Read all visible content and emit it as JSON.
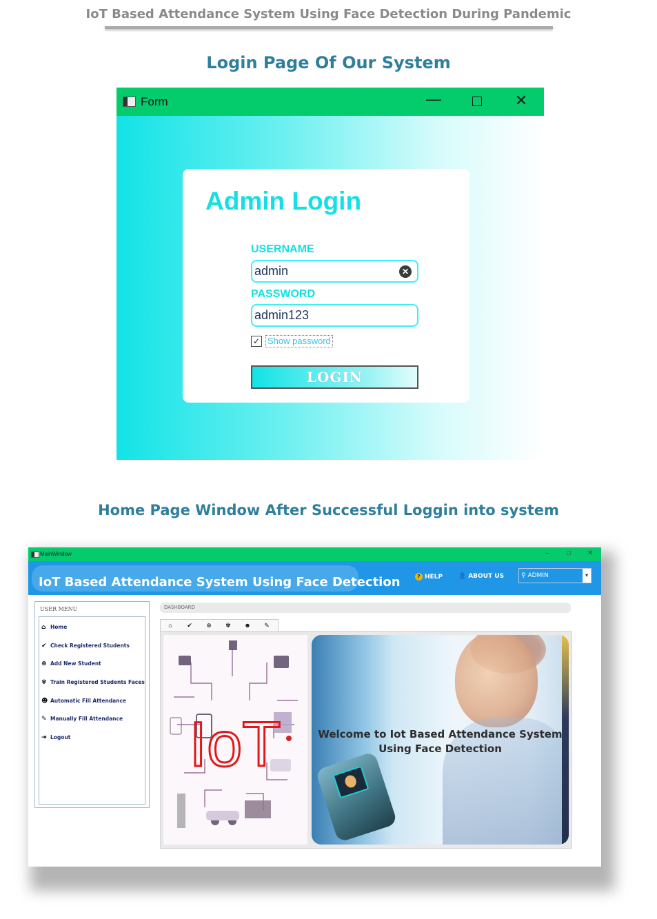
{
  "document": {
    "header": "IoT Based Attendance System Using Face Detection During Pandemic",
    "caption_login": "Login Page Of Our System",
    "caption_home": "Home Page Window After Successful Loggin into system"
  },
  "login_window": {
    "title": "Form",
    "controls": {
      "minimize": "—",
      "close": "✕"
    },
    "heading": "Admin Login",
    "username_label": "USERNAME",
    "username_value": "admin",
    "password_label": "PASSWORD",
    "password_value": "admin123",
    "show_password_label": "Show password",
    "show_password_checked": true,
    "login_button": "LOGIN",
    "colors": {
      "titlebar": "#04cc6d",
      "accent": "#13e0e4"
    }
  },
  "main_window": {
    "title": "MainWindow",
    "controls": {
      "minimize": "–",
      "maximize": "□",
      "close": "✕"
    },
    "app_title": "IoT Based Attendance System Using Face Detection",
    "header_links": {
      "help": "HELP",
      "about": "ABOUT US"
    },
    "admin_select": "ADMIN",
    "user_menu": {
      "title": "USER MENU",
      "items": [
        {
          "label": "Home",
          "icon": "home-icon"
        },
        {
          "label": "Check Registered Students",
          "icon": "check-circle-icon"
        },
        {
          "label": "Add New Student",
          "icon": "plus-circle-icon"
        },
        {
          "label": "Train Registered Students Faces",
          "icon": "train-faces-icon"
        },
        {
          "label": "Automatic Fill Attendance",
          "icon": "auto-attendance-icon"
        },
        {
          "label": "Manually Fill Attendance",
          "icon": "pen-icon"
        },
        {
          "label": "Logout",
          "icon": "logout-icon"
        }
      ]
    },
    "dashboard_label": "DASHBOARD",
    "iot_graphic_label": "IoT",
    "welcome_text_line1": "Welcome to Iot Based Attendance System",
    "welcome_text_line2": "Using Face Detection",
    "colors": {
      "titlebar": "#04cc6d",
      "header": "#1f96e6"
    }
  }
}
